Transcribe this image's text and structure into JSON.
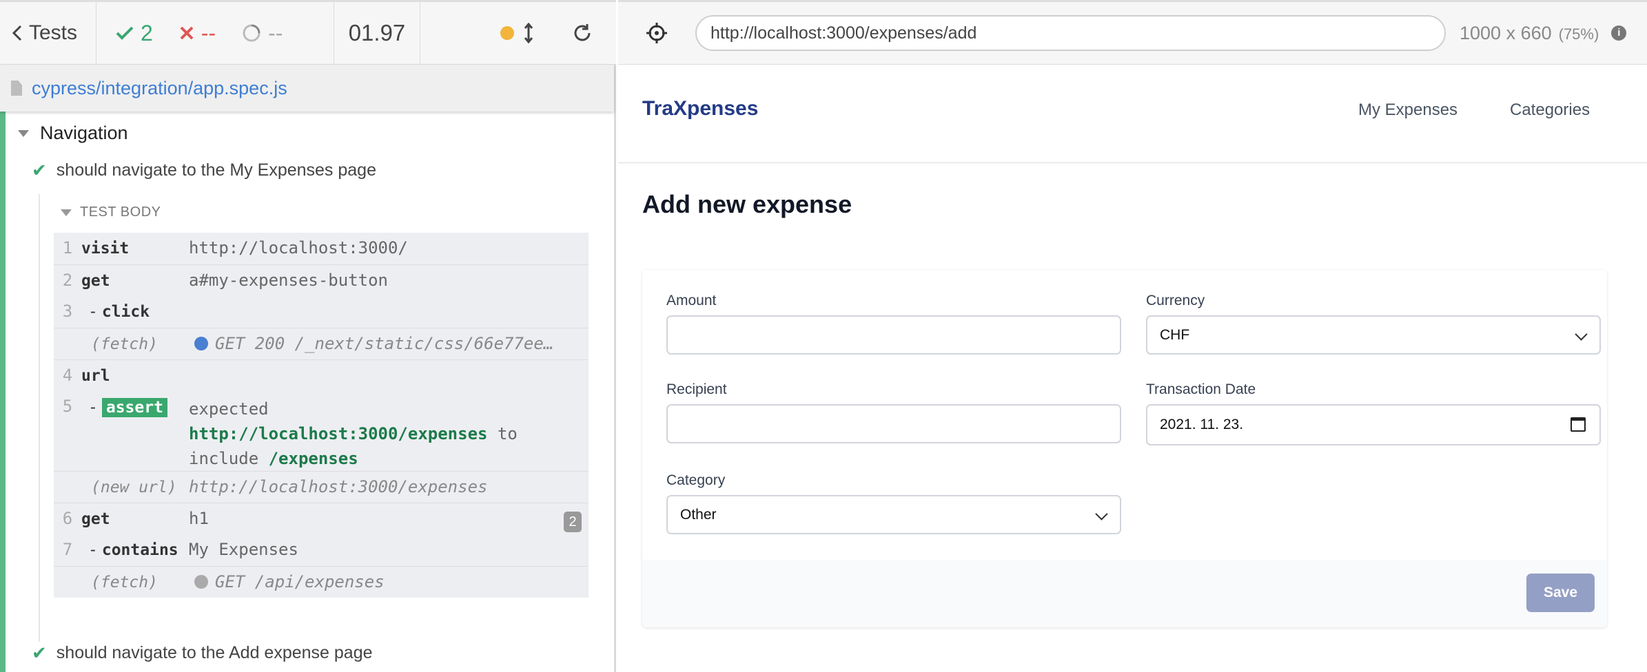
{
  "reporter": {
    "tests_label": "Tests",
    "stats": {
      "passed": "2",
      "failed": "--",
      "pending": "--"
    },
    "duration": "01.97",
    "spec_path": "cypress/integration/app.spec.js",
    "suite_title": "Navigation",
    "tests": [
      {
        "title": "should navigate to the My Expenses page"
      },
      {
        "title": "should navigate to the Add expense page"
      }
    ],
    "test_body_label": "TEST BODY",
    "commands": {
      "c1": {
        "num": "1",
        "name": "visit",
        "msg": "http://localhost:3000/"
      },
      "c2": {
        "num": "2",
        "name": "get",
        "msg": "a#my-expenses-button"
      },
      "c3": {
        "num": "3",
        "name": "click",
        "msg": ""
      },
      "fetch1": {
        "name": "(fetch)",
        "msg": "GET 200 /_next/static/css/66e77ee…"
      },
      "c4": {
        "num": "4",
        "name": "url",
        "msg": ""
      },
      "c5": {
        "num": "5",
        "name": "assert",
        "msg_1": "expected",
        "msg_url": "http://localhost:3000/expenses",
        "msg_to": "to",
        "msg_include": "include",
        "msg_path": "/expenses"
      },
      "newurl": {
        "name": "(new url)",
        "msg": "http://localhost:3000/expenses"
      },
      "c6": {
        "num": "6",
        "name": "get",
        "msg": "h1",
        "count": "2"
      },
      "c7": {
        "num": "7",
        "name": "contains",
        "msg": "My Expenses"
      },
      "fetch2": {
        "name": "(fetch)",
        "msg": "GET /api/expenses"
      }
    }
  },
  "browser": {
    "url": "http://localhost:3000/expenses/add",
    "viewport": "1000 x 660",
    "scale": "(75%)",
    "info_icon": "i"
  },
  "app": {
    "brand": "TraXpenses",
    "nav": {
      "expenses": "My Expenses",
      "categories": "Categories"
    },
    "page_title": "Add new expense",
    "form": {
      "amount_label": "Amount",
      "amount_value": "",
      "currency_label": "Currency",
      "currency_value": "CHF",
      "recipient_label": "Recipient",
      "recipient_value": "",
      "date_label": "Transaction Date",
      "date_value": "2021. 11. 23.",
      "category_label": "Category",
      "category_value": "Other",
      "save_label": "Save"
    }
  },
  "colors": {
    "pass": "#3aa672",
    "fail": "#e05555",
    "brand": "#233b86",
    "save_button": "#949fc5"
  }
}
